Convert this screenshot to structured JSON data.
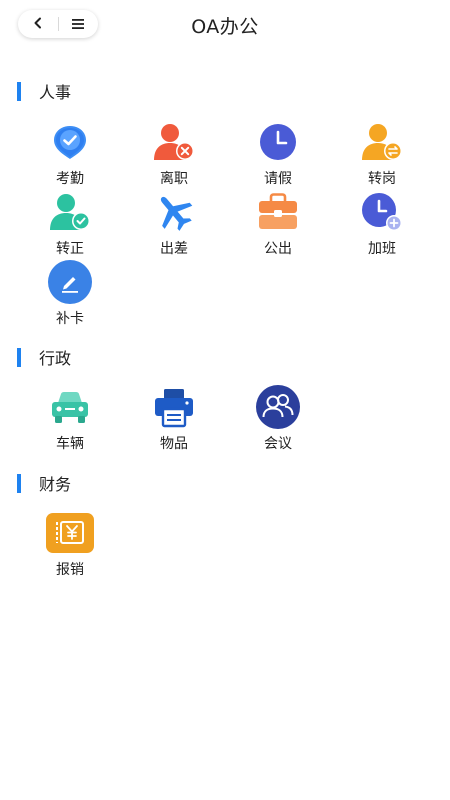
{
  "header": {
    "title": "OA办公",
    "back_icon": "chevron-left-icon",
    "menu_icon": "menu-icon"
  },
  "sections": [
    {
      "title": "人事",
      "items": [
        {
          "label": "考勤",
          "icon": "attendance-check-icon"
        },
        {
          "label": "离职",
          "icon": "resign-person-icon"
        },
        {
          "label": "请假",
          "icon": "leave-clock-icon"
        },
        {
          "label": "转岗",
          "icon": "transfer-person-icon"
        },
        {
          "label": "转正",
          "icon": "regularize-person-icon"
        },
        {
          "label": "出差",
          "icon": "airplane-icon"
        },
        {
          "label": "公出",
          "icon": "briefcase-icon"
        },
        {
          "label": "加班",
          "icon": "overtime-clock-icon"
        },
        {
          "label": "补卡",
          "icon": "pencil-icon"
        }
      ]
    },
    {
      "title": "行政",
      "items": [
        {
          "label": "车辆",
          "icon": "car-icon"
        },
        {
          "label": "物品",
          "icon": "printer-icon"
        },
        {
          "label": "会议",
          "icon": "meeting-people-icon"
        }
      ]
    },
    {
      "title": "财务",
      "items": [
        {
          "label": "报销",
          "icon": "reimburse-ticket-icon"
        }
      ]
    }
  ],
  "colors": {
    "accent": "#1e82f0",
    "red_orange": "#f05a3c",
    "purple_blue": "#4a5bd6",
    "amber": "#f5a623",
    "teal": "#2cc2a0",
    "orange": "#f58a45",
    "navy": "#1e4ea6",
    "gold": "#f0a020"
  }
}
